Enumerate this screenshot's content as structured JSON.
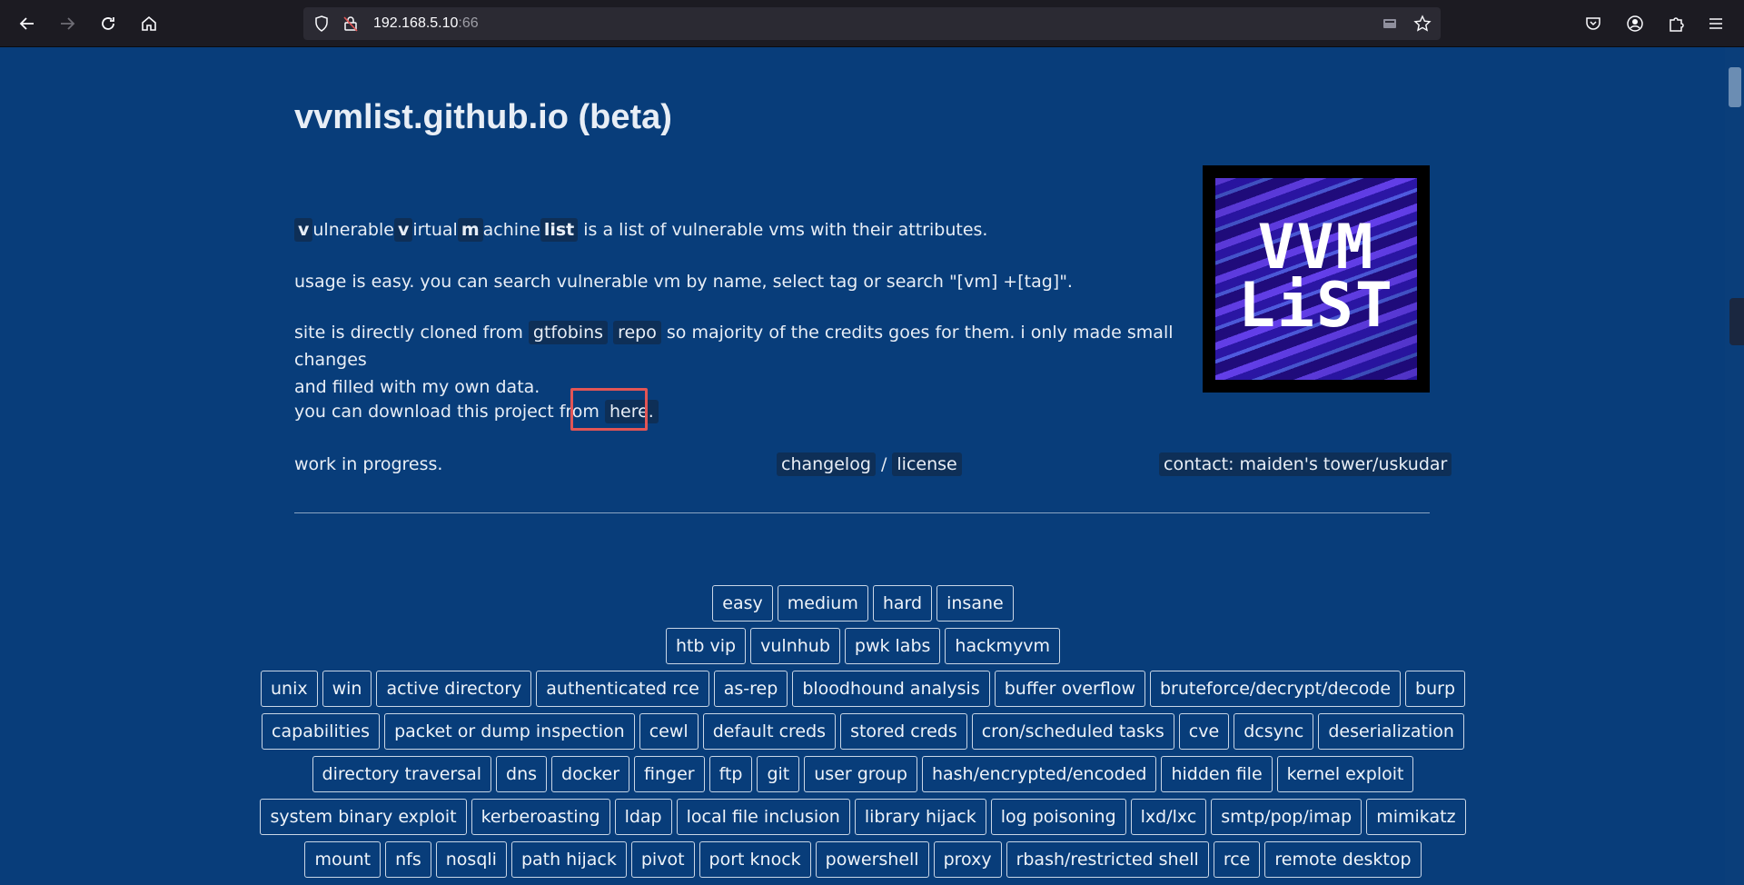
{
  "browser": {
    "url_host": "192.168.5.10",
    "url_port": ":66"
  },
  "page": {
    "title": "vvmlist.github.io (beta)",
    "intro": {
      "w1_letter": "v",
      "w1_rest": "ulnerable",
      "w2_letter": "v",
      "w2_rest": "irtual",
      "w3_letter": "m",
      "w3_rest": "achine",
      "w4": "list",
      "rest": " is a list of vulnerable vms with their attributes."
    },
    "usage": "usage is easy. you can search vulnerable vm by name, select tag or search \"[vm] +[tag]\".",
    "cloned_prefix": "site is directly cloned from ",
    "gtfobins_link": "gtfobins",
    "repo_link": "repo",
    "cloned_suffix": " so majority of the credits goes for them. i only made small changes",
    "cloned_line2": "and filled with my own data.",
    "download_prefix": "you can download this project from ",
    "here_link": "here.",
    "wip": "work in progress.",
    "changelog_link": "changelog",
    "slash": "/",
    "license_link": "license",
    "contact_link": "contact: maiden's tower/uskudar",
    "logo_line1": "VVM",
    "logo_line2": "LiST"
  },
  "tags": [
    [
      "easy",
      "medium",
      "hard",
      "insane"
    ],
    [
      "htb vip",
      "vulnhub",
      "pwk labs",
      "hackmyvm"
    ],
    [
      "unix",
      "win",
      "active directory",
      "authenticated rce",
      "as-rep",
      "bloodhound analysis",
      "buffer overflow",
      "bruteforce/decrypt/decode",
      "burp"
    ],
    [
      "capabilities",
      "packet or dump inspection",
      "cewl",
      "default creds",
      "stored creds",
      "cron/scheduled tasks",
      "cve",
      "dcsync",
      "deserialization"
    ],
    [
      "directory traversal",
      "dns",
      "docker",
      "finger",
      "ftp",
      "git",
      "user group",
      "hash/encrypted/encoded",
      "hidden file",
      "kernel exploit"
    ],
    [
      "system binary exploit",
      "kerberoasting",
      "ldap",
      "local file inclusion",
      "library hijack",
      "log poisoning",
      "lxd/lxc",
      "smtp/pop/imap",
      "mimikatz"
    ],
    [
      "mount",
      "nfs",
      "nosqli",
      "path hijack",
      "pivot",
      "port knock",
      "powershell",
      "proxy",
      "rbash/restricted shell",
      "rce",
      "remote desktop"
    ]
  ]
}
